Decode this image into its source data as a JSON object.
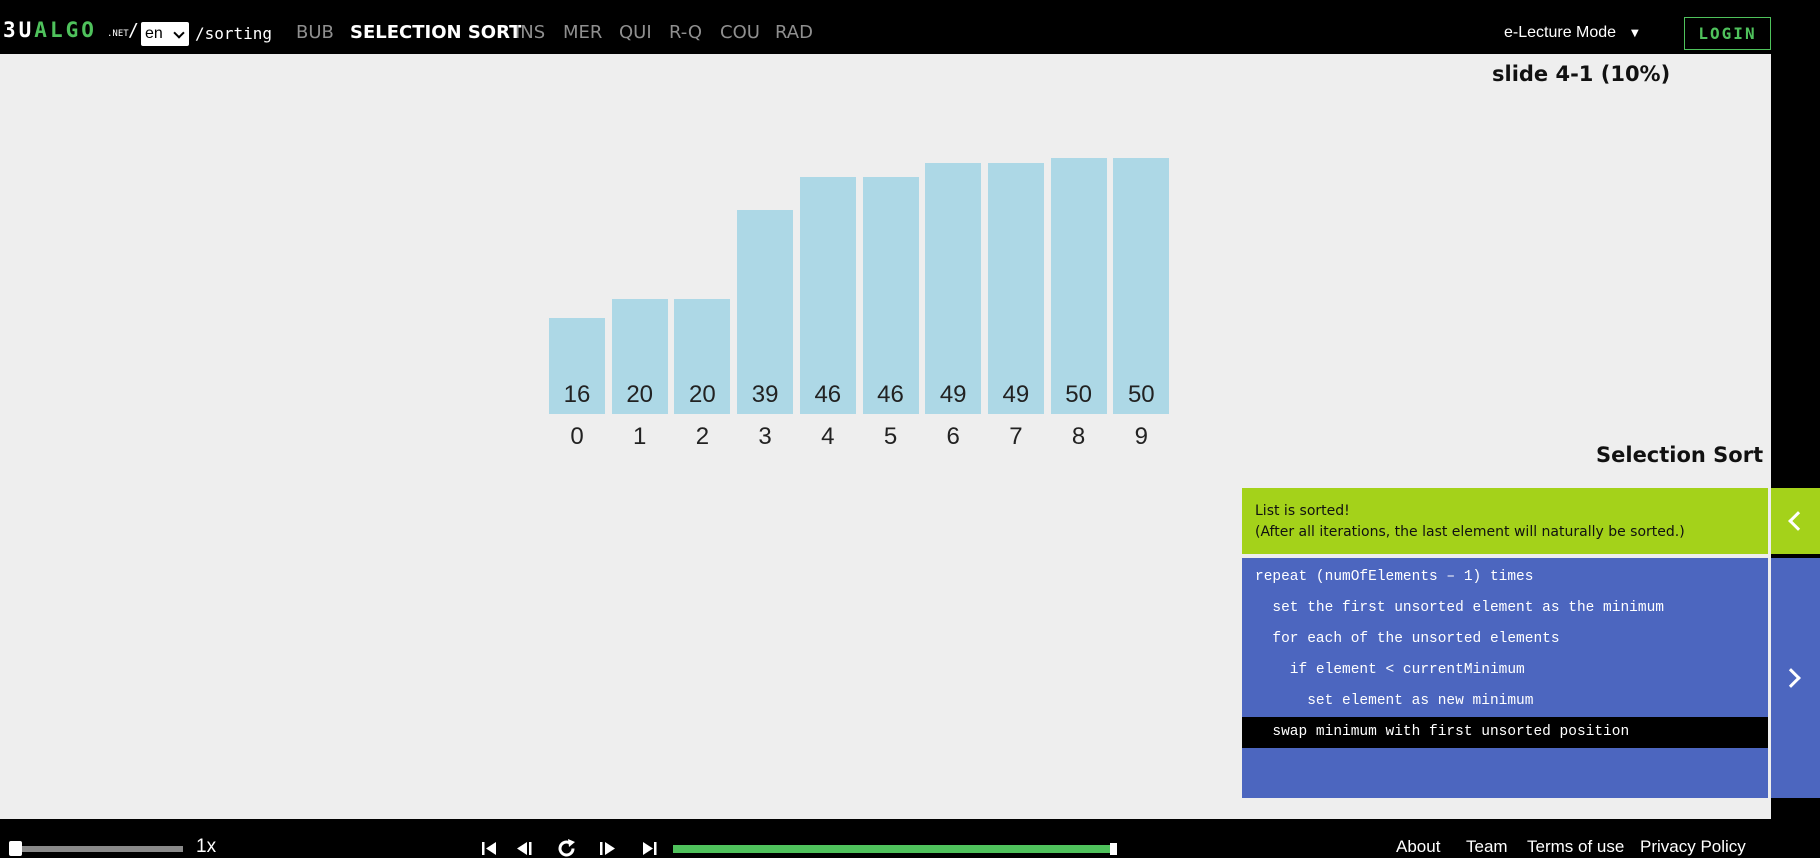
{
  "header": {
    "logo_prefix": "ЗU",
    "logo_green": "ALGO",
    "logo_tld": ".NET",
    "language": "en",
    "path": "/sorting",
    "nav": [
      {
        "label": "BUB",
        "active": false
      },
      {
        "label": "SELECTION SORT",
        "active": true
      },
      {
        "label": "INS",
        "active": false
      },
      {
        "label": "MER",
        "active": false
      },
      {
        "label": "QUI",
        "active": false
      },
      {
        "label": "R-Q",
        "active": false
      },
      {
        "label": "COU",
        "active": false
      },
      {
        "label": "RAD",
        "active": false
      }
    ],
    "mode": "e-Lecture Mode",
    "login": "LOGIN"
  },
  "slide_label": "slide 4-1 (10%)",
  "chart_data": {
    "type": "bar",
    "categories": [
      "0",
      "1",
      "2",
      "3",
      "4",
      "5",
      "6",
      "7",
      "8",
      "9"
    ],
    "values": [
      16,
      20,
      20,
      39,
      46,
      46,
      49,
      49,
      50,
      50
    ],
    "color": "#add8e6"
  },
  "panel": {
    "title": "Selection Sort",
    "status_lines": [
      "List is sorted!",
      "(After all iterations, the last element will naturally be sorted.)"
    ],
    "code": [
      {
        "text": "repeat (numOfElements – 1) times",
        "highlight": false
      },
      {
        "text": "  set the first unsorted element as the minimum",
        "highlight": false
      },
      {
        "text": "  for each of the unsorted elements",
        "highlight": false
      },
      {
        "text": "    if element < currentMinimum",
        "highlight": false
      },
      {
        "text": "      set element as new minimum",
        "highlight": false
      },
      {
        "text": "  swap minimum with first unsorted position",
        "highlight": true
      }
    ],
    "status_color": "#a4d21a",
    "code_color": "#4c66bf"
  },
  "footer": {
    "speed": "1x",
    "speed_level": 0.0,
    "progress": 1.0,
    "links": [
      "About",
      "Team",
      "Terms of use",
      "Privacy Policy"
    ]
  },
  "icons": {
    "collapse": "chevron-left-icon",
    "next": "chevron-right-icon",
    "controls": [
      "skip-to-start-icon",
      "step-back-icon",
      "replay-icon",
      "step-forward-icon",
      "skip-to-end-icon"
    ]
  }
}
